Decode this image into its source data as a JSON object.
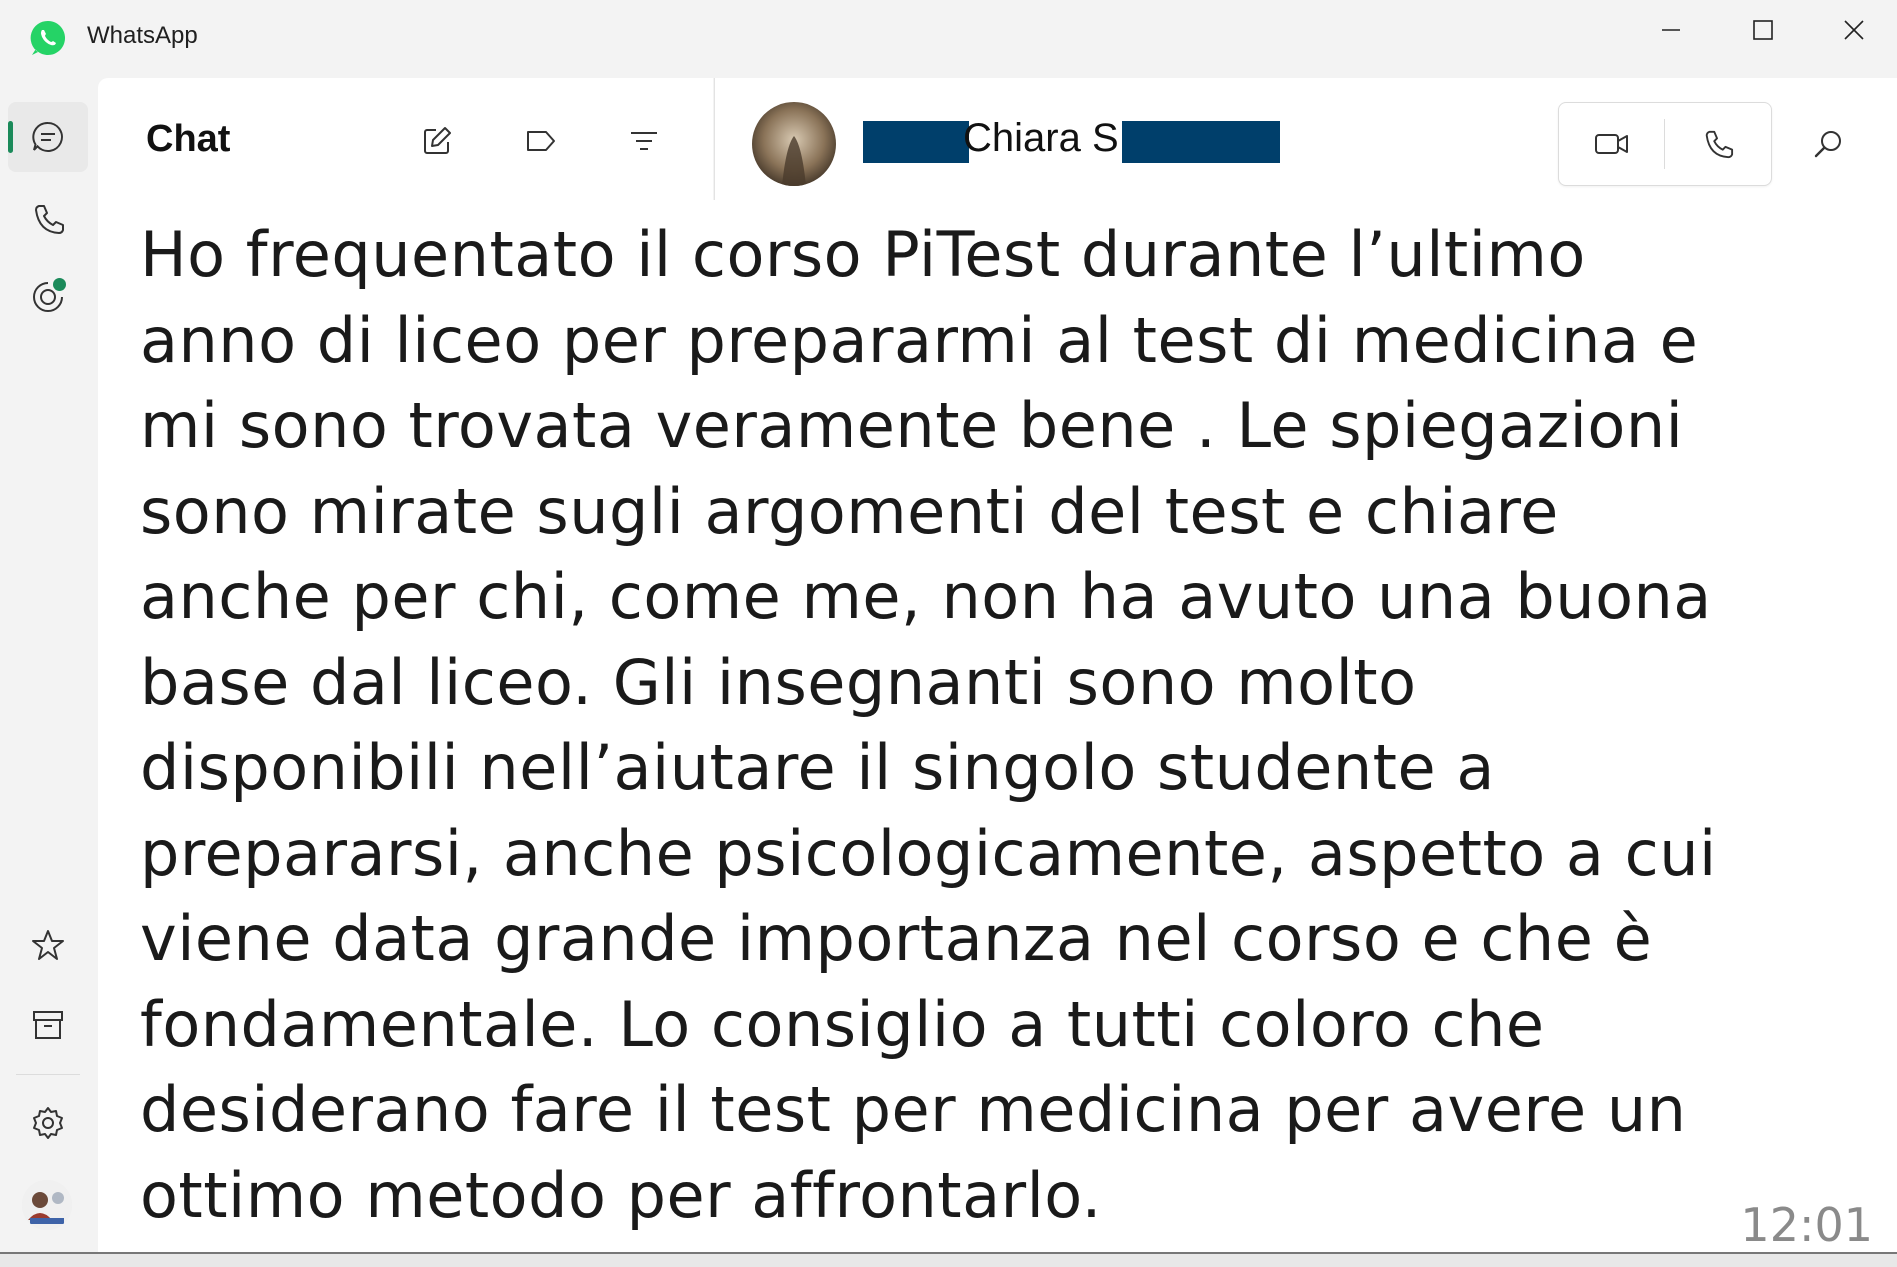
{
  "window": {
    "app_title": "WhatsApp",
    "controls": {
      "minimize": "minimize-icon",
      "maximize": "maximize-icon",
      "close": "close-icon"
    }
  },
  "colors": {
    "brand_green": "#25d366",
    "accent_green": "#1b8a5a",
    "redaction": "#003f6b"
  },
  "rail": {
    "items": [
      "chats-icon",
      "calls-icon",
      "status-icon",
      "starred-icon",
      "archive-icon",
      "settings-icon",
      "profile-avatar"
    ]
  },
  "chat_list": {
    "title": "Chat",
    "icons": [
      "new-chat-icon",
      "labels-icon",
      "filter-icon"
    ]
  },
  "conversation": {
    "contact_name": "Chiara S",
    "header_icons": [
      "video-call-icon",
      "voice-call-icon",
      "search-icon"
    ],
    "message": {
      "text": "Ho frequentato il corso PiTest durante l’ultimo\nanno di liceo per prepararmi al test di medicina e\nmi sono trovata veramente bene . Le spiegazioni\nsono mirate sugli argomenti del test e chiare\nanche per chi, come me, non ha avuto una buona\nbase dal liceo. Gli insegnanti  sono molto\ndisponibili  nell’aiutare il singolo studente  a\nprepararsi, anche psicologicamente, aspetto a cui\nviene data grande importanza nel corso e che è\nfondamentale. Lo consiglio a tutti coloro che\ndesiderano fare il test per medicina per avere un\nottimo metodo per affrontarlo.",
      "time": "12:01"
    }
  }
}
